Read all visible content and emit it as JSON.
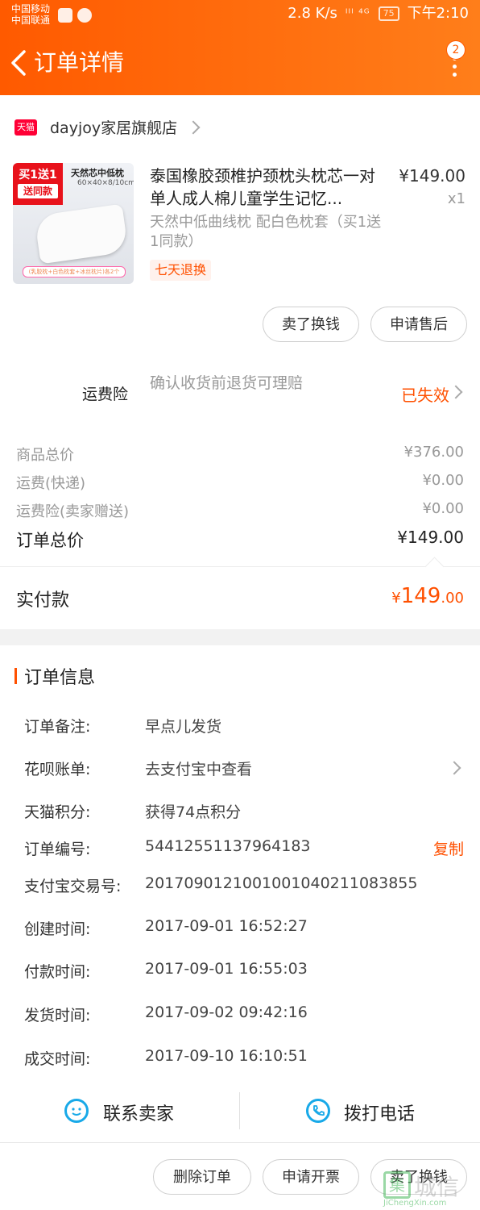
{
  "status_bar": {
    "carrier1": "中国移动",
    "carrier2": "中国联通",
    "speed": "2.8 K/s",
    "signal": "ᴵᴵᴵ ⁴ᴳ",
    "battery": "75",
    "time": "下午2:10"
  },
  "nav": {
    "title": "订单详情",
    "badge": "2",
    "back_icon": "chevron-left-icon",
    "more_icon": "more-vertical-icon"
  },
  "shop": {
    "logo_text": "天猫",
    "name": "dayjoy家居旗舰店"
  },
  "product": {
    "image_ribbon_1": "买1送1",
    "image_ribbon_2": "送同款",
    "image_heading": "天然芯中低枕",
    "image_size": "60×40×8/10cm",
    "image_footer": "(乳胶枕+白色枕套+冰丝枕片)各2个",
    "title": "泰国橡胶颈椎护颈枕头枕芯一对单人成人棉儿童学生记忆...",
    "price": "¥149.00",
    "qty": "x1",
    "sku": "天然中低曲线枕 配白色枕套（买1送1同款）",
    "tag": "七天退换"
  },
  "actions": {
    "sell_exchange": "卖了换钱",
    "after_sale": "申请售后"
  },
  "insurance": {
    "label": "运费险",
    "desc": "确认收货前退货可理赔",
    "status": "已失效"
  },
  "summary": {
    "goods_label": "商品总价",
    "goods_value": "¥376.00",
    "shipping_label": "运费(快递)",
    "shipping_value": "¥0.00",
    "ins_label": "运费险(卖家赠送)",
    "ins_value": "¥0.00",
    "total_label": "订单总价",
    "total_value": "¥149.00",
    "paid_label": "实付款",
    "paid_symbol": "¥",
    "paid_int": "149",
    "paid_dec": ".00"
  },
  "order_info": {
    "section_title": "订单信息",
    "rows": [
      {
        "label": "订单备注:",
        "value": "早点儿发货"
      },
      {
        "label": "花呗账单:",
        "value": "去支付宝中查看"
      },
      {
        "label": "天猫积分:",
        "value": "获得74点积分"
      },
      {
        "label": "订单编号:",
        "value": "54412551137964183"
      },
      {
        "label": "支付宝交易号:",
        "value": "2017090121001001040211083855"
      },
      {
        "label": "创建时间:",
        "value": "2017-09-01 16:52:27"
      },
      {
        "label": "付款时间:",
        "value": "2017-09-01 16:55:03"
      },
      {
        "label": "发货时间:",
        "value": "2017-09-02 09:42:16"
      },
      {
        "label": "成交时间:",
        "value": "2017-09-10 16:10:51"
      }
    ],
    "copy_label": "复制"
  },
  "contact": {
    "seller_label": "联系卖家",
    "phone_label": "拨打电话"
  },
  "bottom": {
    "delete": "删除订单",
    "invoice": "申请开票",
    "sell_exchange": "卖了换钱"
  },
  "watermark": {
    "logo_char": "集",
    "text": "城信",
    "url": "JiChengXin.com"
  },
  "colors": {
    "accent": "#ff5000",
    "header_start": "#ff5a00",
    "header_end": "#ff7e1a",
    "tmall": "#ff0036",
    "contact_icon": "#18a9e8"
  }
}
